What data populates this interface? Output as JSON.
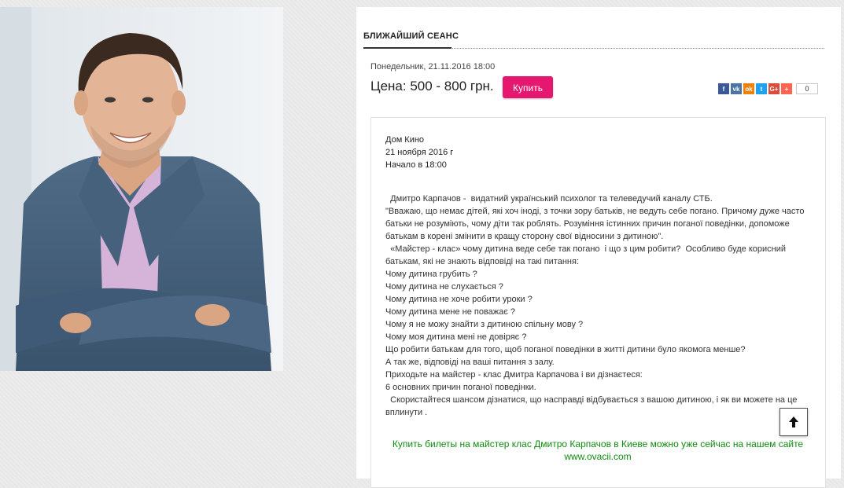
{
  "session": {
    "section_title": "БЛИЖАЙШИЙ СЕАНС",
    "date": "Понедельник, 21.11.2016 18:00",
    "price": "Цена: 500 - 800 грн.",
    "buy_label": "Купить"
  },
  "share": {
    "icons": [
      {
        "name": "facebook-icon",
        "glyph": "f",
        "color": "#3b5998"
      },
      {
        "name": "vk-icon",
        "glyph": "vk",
        "color": "#4c75a3"
      },
      {
        "name": "odnoklassniki-icon",
        "glyph": "ok",
        "color": "#ee8208"
      },
      {
        "name": "twitter-icon",
        "glyph": "t",
        "color": "#1da1f2"
      },
      {
        "name": "google-plus-icon",
        "glyph": "G+",
        "color": "#dd4b39"
      },
      {
        "name": "more-share-icon",
        "glyph": "+",
        "color": "#ff6550"
      }
    ],
    "count": "0"
  },
  "event": {
    "venue": "Дом Кино",
    "date": "21 ноября 2016 г",
    "start": "Начало в 18:00",
    "paragraphs": [
      "  Дмитро Карпачов -  видатний український психолог та телеведучий каналу СТБ.",
      "\"Вважаю, що немає дітей, які хоч іноді, з точки зору батьків, не ведуть себе погано. Причому дуже часто батьки не розуміють, чому діти так роблять. Розуміння істинних причин поганої поведінки, допоможе батькам в корені змінити в кращу сторону свої відносини з дитиною\".",
      "  «Майстер - клас» чому дитина веде себе так погано  і що з цим робити?  Особливо буде корисний батькам, які не знають відповіді на такі питання:",
      "Чому дитина грубить ?",
      "Чому дитина не слухається ?",
      "Чому дитина не хоче робити уроки ?",
      "Чому дитина мене не поважає ?",
      "Чому я не можу знайти з дитиною спільну мову ?",
      "Чому моя дитина мені не довіряє ?",
      "Що робити батькам для того, щоб поганої поведінки в житті дитини було якомога менше?",
      "А так же, відповіді на ваші питання з залу.",
      "Приходьте на майстер - клас Дмитра Карпачова і ви дізнаєтеся:",
      "6 основних причин поганої поведінки.",
      "  Скористайтеся шансом дізнатися, що насправді відбувається з вашою дитиною, і як ви можете на це вплинути ."
    ],
    "promo": "Купить билеты на майстер клас Дмитро Карпачов в Киеве можно уже сейчас на нашем сайте www.ovacii.com"
  },
  "colors": {
    "buy_button": "#e6176f",
    "promo_text": "#118a11"
  }
}
